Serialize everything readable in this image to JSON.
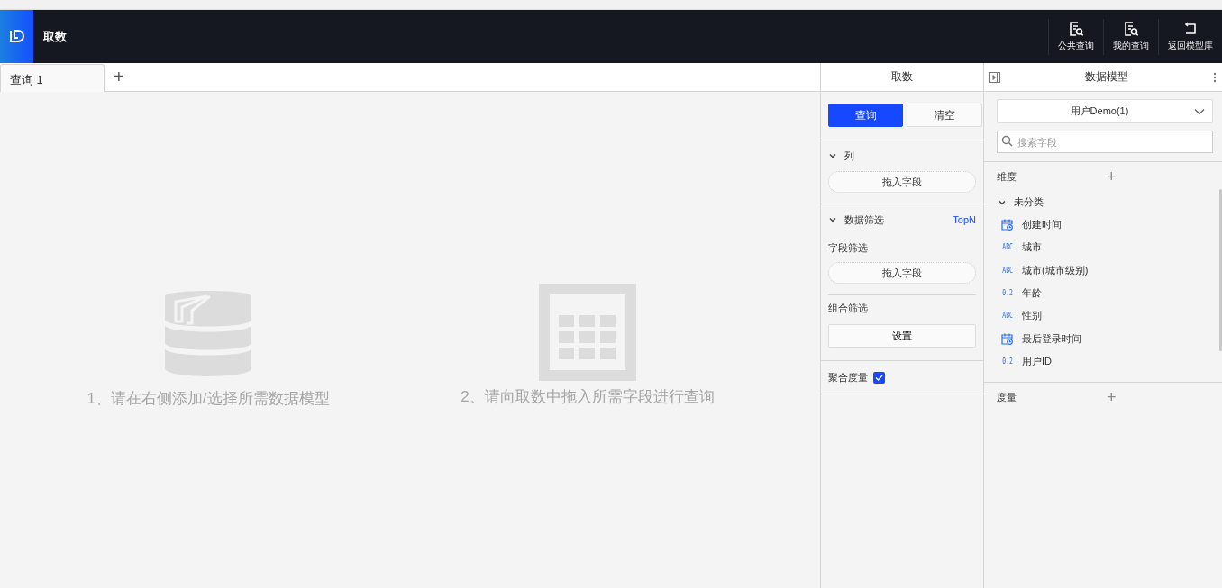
{
  "header": {
    "title": "取数",
    "actions": [
      {
        "label": "公共查询",
        "kind": "doc"
      },
      {
        "label": "我的查询",
        "kind": "doc"
      },
      {
        "label": "返回模型库",
        "kind": "back"
      }
    ]
  },
  "tabs": [
    {
      "label": "查询 1",
      "selected": true
    }
  ],
  "add_tab": "+",
  "hints": [
    {
      "text": "1、请在右侧添加/选择所需数据模型",
      "kind": "database"
    },
    {
      "text": "2、请向取数中拖入所需字段进行查询",
      "kind": "table"
    }
  ],
  "fetch_panel": {
    "title": "取数",
    "query_button": "查询",
    "clear_button": "清空",
    "columns_section": {
      "title": "列",
      "expanded": true,
      "drop": "拖入字段"
    },
    "filter_section": {
      "title": "数据筛选",
      "expanded": true,
      "link": "TopN",
      "field_filter": "字段筛选",
      "drop": "拖入字段",
      "combo_filter": "组合筛选",
      "setup_button": "设置"
    },
    "aggregate": {
      "label": "聚合度量",
      "checked": true
    }
  },
  "model_panel": {
    "title": "数据模型",
    "model_select": "用户Demo(1)",
    "search": {
      "placeholder": "搜索字段"
    },
    "dimensions": {
      "title": "维度",
      "add": "+",
      "groups": [
        {
          "title": "未分类",
          "expanded": true,
          "fields": [
            {
              "name": "创建时间",
              "kind": "date"
            },
            {
              "name": "城市",
              "kind": "text",
              "badge": "ABC"
            },
            {
              "name": "城市(城市级别)",
              "kind": "text",
              "badge": "ABC"
            },
            {
              "name": "年龄",
              "kind": "number",
              "badge": "0.2"
            },
            {
              "name": "性别",
              "kind": "text",
              "badge": "ABC"
            },
            {
              "name": "最后登录时间",
              "kind": "date"
            },
            {
              "name": "用户ID",
              "kind": "number",
              "badge": "0.2"
            }
          ]
        }
      ]
    },
    "measures": {
      "title": "度量",
      "add": "+"
    }
  }
}
